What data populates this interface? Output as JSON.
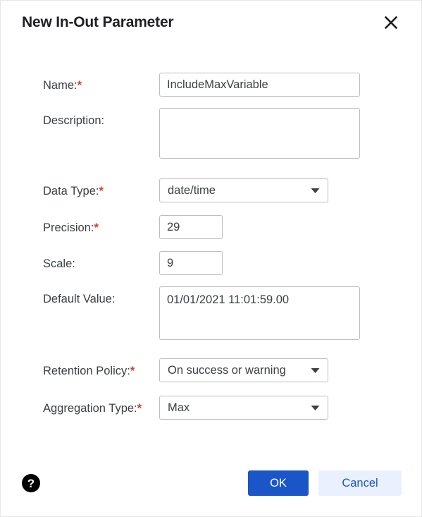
{
  "dialog": {
    "title": "New In-Out Parameter",
    "close_icon": "close-icon"
  },
  "form": {
    "name": {
      "label": "Name:",
      "required_marker": "*",
      "value": "IncludeMaxVariable",
      "placeholder": ""
    },
    "description": {
      "label": "Description:",
      "required_marker": "",
      "value": "",
      "placeholder": ""
    },
    "data_type": {
      "label": "Data Type:",
      "required_marker": "*",
      "value": "date/time",
      "arrow_icon": "chevron-down-icon"
    },
    "precision": {
      "label": "Precision:",
      "required_marker": "*",
      "value": "29",
      "placeholder": ""
    },
    "scale": {
      "label": "Scale:",
      "required_marker": "",
      "value": "9",
      "placeholder": ""
    },
    "default_value": {
      "label": "Default Value:",
      "required_marker": "",
      "value": "01/01/2021 11:01:59.00",
      "placeholder": ""
    },
    "retention_policy": {
      "label": "Retention Policy:",
      "required_marker": "*",
      "value": "On success or warning",
      "arrow_icon": "chevron-down-icon"
    },
    "aggregation_type": {
      "label": "Aggregation Type:",
      "required_marker": "*",
      "value": "Max",
      "arrow_icon": "chevron-down-icon"
    }
  },
  "footer": {
    "help_icon_glyph": "?",
    "ok_label": "OK",
    "cancel_label": "Cancel"
  },
  "colors": {
    "primary": "#1a56c7",
    "secondary_bg": "#eaf0fd",
    "required_asterisk": "#ea3323",
    "label_text": "#3c4043",
    "border": "#bdbdbd"
  }
}
